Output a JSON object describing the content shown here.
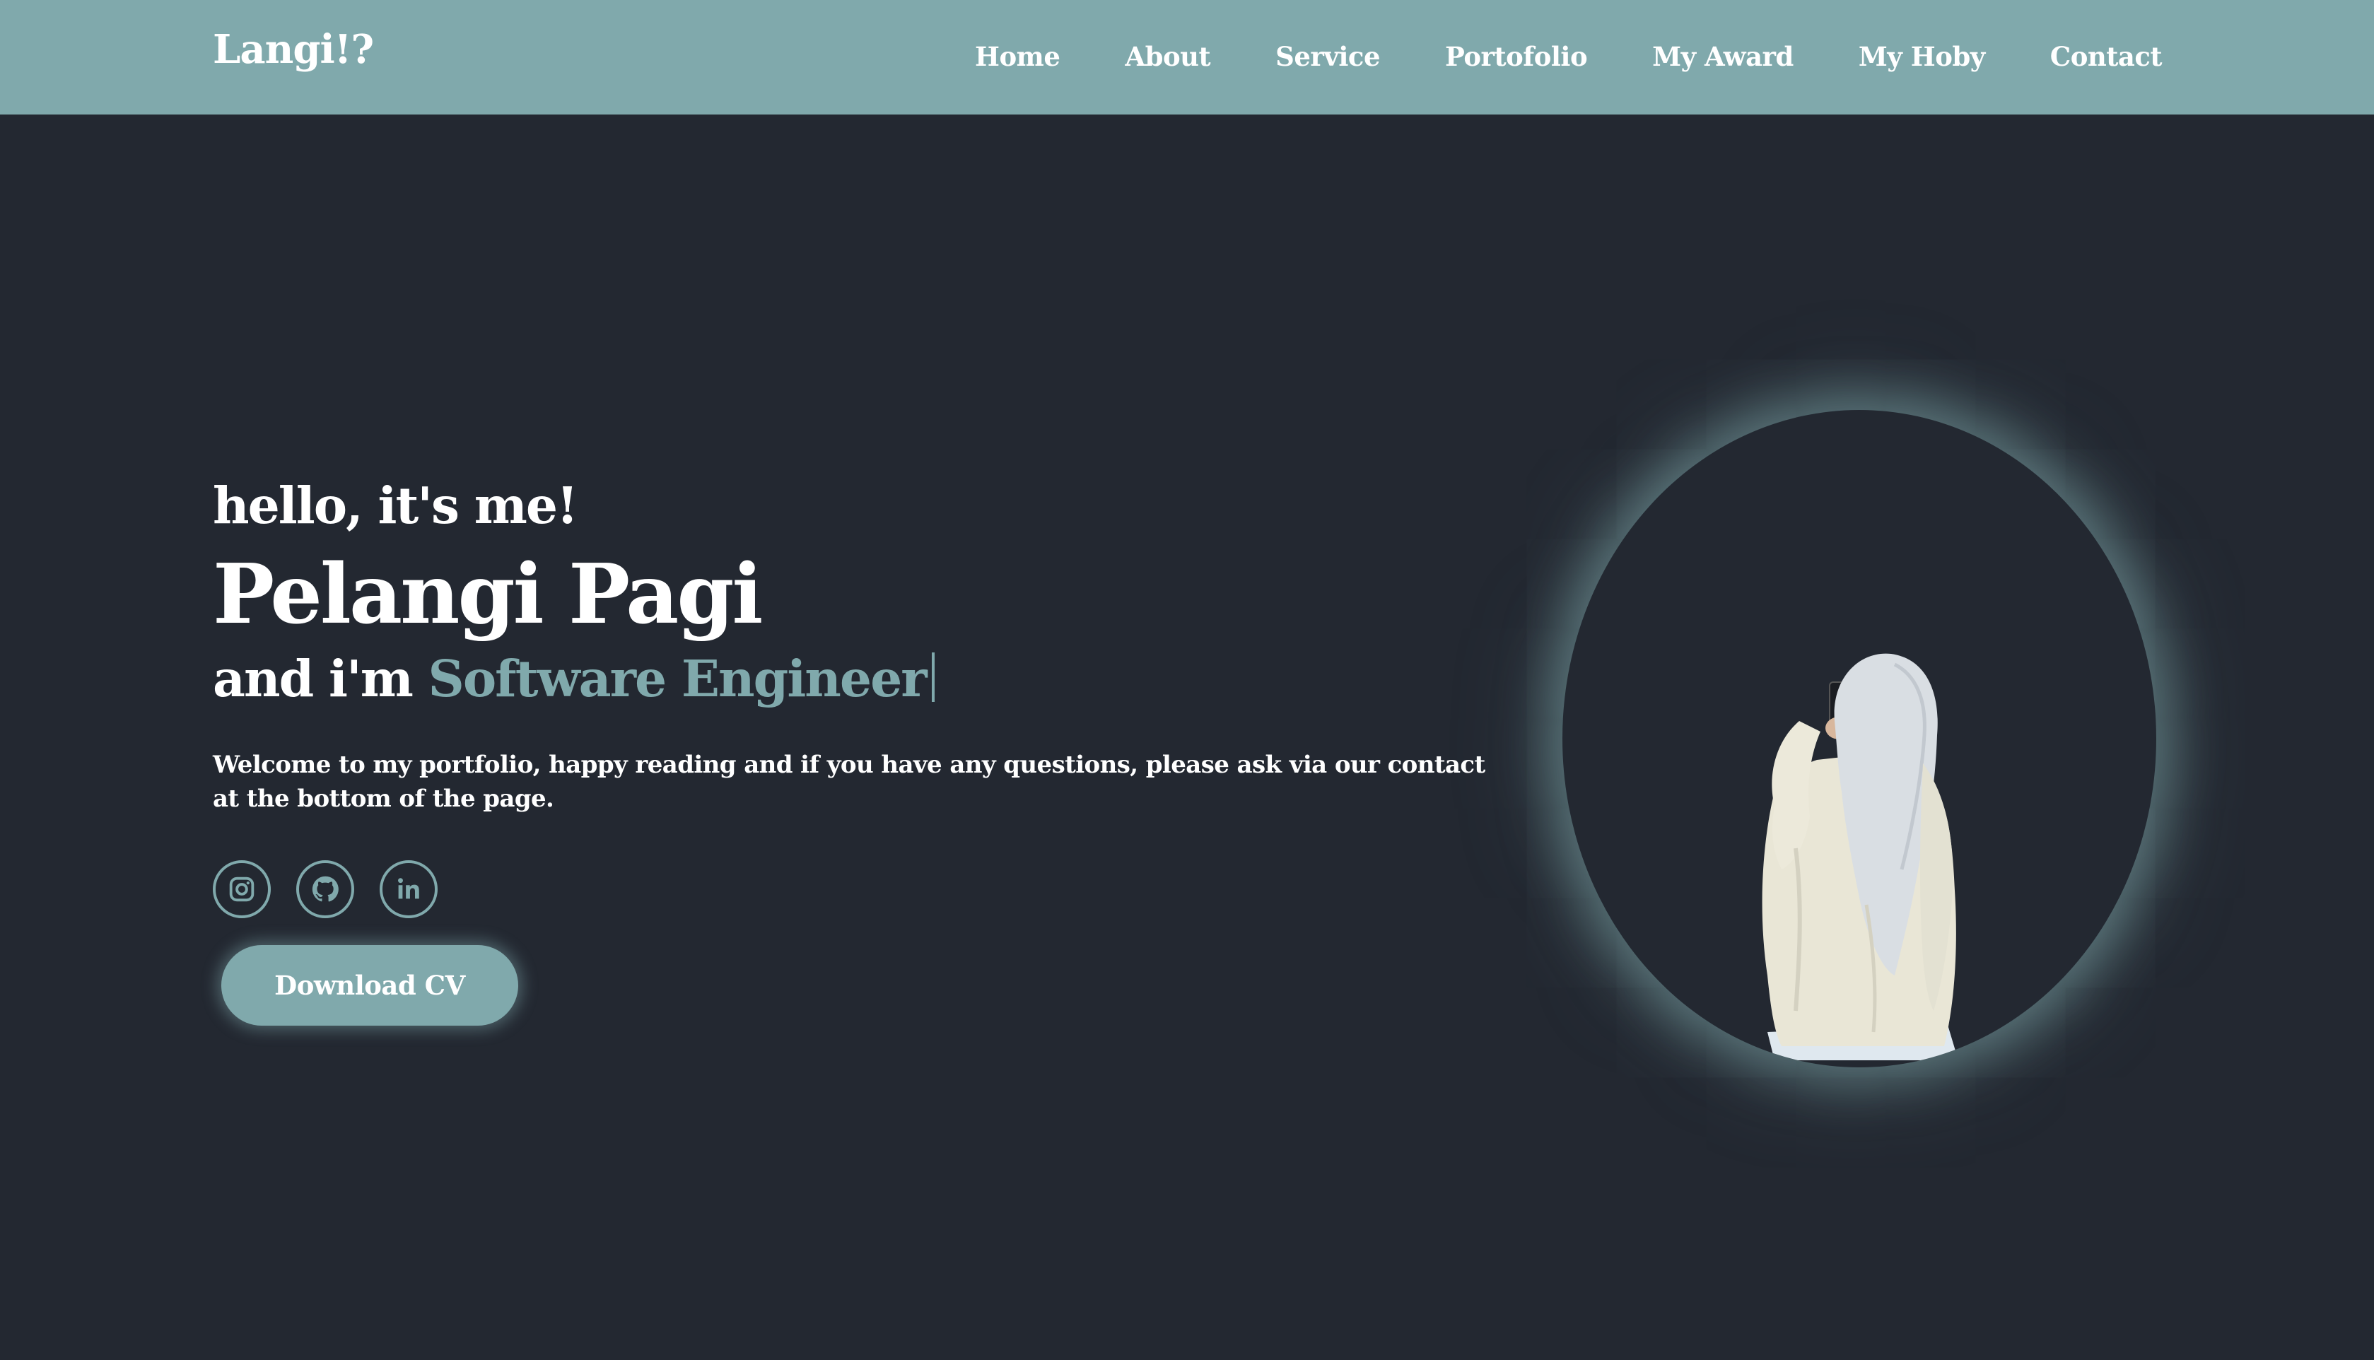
{
  "header": {
    "logo": "Langi!?",
    "nav": [
      "Home",
      "About",
      "Service",
      "Portofolio",
      "My Award",
      "My Hoby",
      "Contact"
    ]
  },
  "hero": {
    "greeting": "hello, it's me!",
    "name": "Pelangi Pagi",
    "role_prefix": "and i'm ",
    "role": "Software Engineer",
    "intro": "Welcome to my portfolio, happy reading and if you have any questions, please ask via our contact at the bottom of the page.",
    "socials": [
      "instagram-icon",
      "github-icon",
      "linkedin-icon"
    ],
    "download_label": "Download CV"
  },
  "colors": {
    "background": "#232831",
    "accent": "#80a9ac",
    "text": "#ffffff"
  }
}
